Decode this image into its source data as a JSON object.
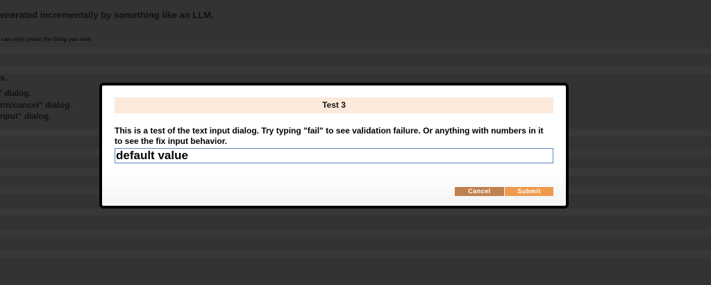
{
  "background": {
    "heading": "enerated incrementally by something like an LLM.",
    "tagline": "can only create the thing you love.",
    "list_end": "s.",
    "line_1": "' dialog.",
    "line_2": "rm/cancel\" dialog.",
    "line_3": "nput\" dialog."
  },
  "dialog": {
    "title": "Test 3",
    "message": "This is a test of the text input dialog. Try typing \"fail\" to see validation failure. Or anything with numbers in it to see the fix input behavior.",
    "input_value": "default value",
    "cancel_label": "Cancel",
    "submit_label": "Submit"
  },
  "colors": {
    "overlay": "#333331",
    "title_bar": "#fbe9dc",
    "cancel_button": "#c08150",
    "submit_button": "#ef9a4c",
    "input_border": "#5b86c4"
  }
}
